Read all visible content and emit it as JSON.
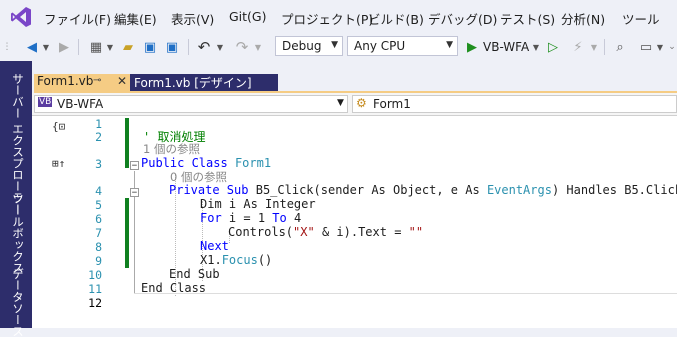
{
  "menu": {
    "items": [
      "ファイル(F)",
      "編集(E)",
      "表示(V)",
      "Git(G)",
      "プロジェクト(P)",
      "ビルド(B)",
      "デバッグ(D)",
      "テスト(S)",
      "分析(N)",
      "ツール"
    ]
  },
  "toolbar": {
    "config": "Debug",
    "platform": "Any CPU",
    "run_target": "VB-WFA"
  },
  "side_tabs": [
    "サーバー エクスプローラー",
    "ツールボックス",
    "データソース"
  ],
  "tabs": [
    {
      "label": "Form1.vb",
      "active": true
    },
    {
      "label": "Form1.vb [デザイン]",
      "active": false
    }
  ],
  "navbar": {
    "project": "VB-WFA",
    "member": "Form1"
  },
  "editor": {
    "line_numbers": [
      "1",
      "2",
      "3",
      "4",
      "5",
      "6",
      "7",
      "8",
      "9",
      "10",
      "11",
      "12"
    ],
    "comment_line": "' 取消処理",
    "refs_class": "1 個の参照",
    "refs_sub": "0 個の参照",
    "tokens": {
      "public_class": "Public Class",
      "form1": "Form1",
      "private_sub": "Private Sub",
      "sub_name": "B5_Click",
      "sender": "(sender",
      "as1": "As Object, e As",
      "eventargs": "EventArgs",
      "handles": ") Handles B5.Click",
      "dim_line": "Dim i As Integer",
      "for_kw": "For",
      "for_mid": "i = 1",
      "to_kw": "To",
      "for_end": "4",
      "controls": "Controls(",
      "str_x": "\"X\"",
      "controls_mid": " & i).Text = ",
      "str_empty": "\"\"",
      "next_kw": "Next",
      "focus": "X1.",
      "focus_call": "Focus",
      "focus_end": "()",
      "end_sub": "End Sub",
      "end_class": "End Class"
    }
  },
  "colors": {
    "accent_tab": "#f5cc84",
    "side_panel": "#2d2d6b",
    "change_bar": "#108020"
  }
}
